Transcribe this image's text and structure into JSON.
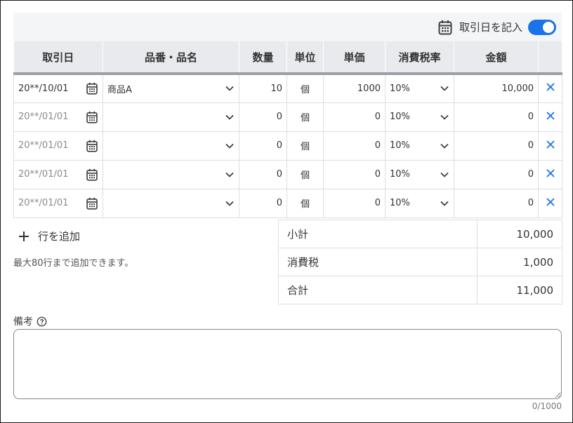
{
  "toolbar": {
    "record_date_label": "取引日を記入",
    "toggle_on": true
  },
  "table": {
    "headers": [
      "取引日",
      "品番・品名",
      "数量",
      "単位",
      "単価",
      "消費税率",
      "金額",
      ""
    ],
    "rows": [
      {
        "date": "20**/10/01",
        "date_placeholder": false,
        "item": "商品A",
        "qty": "10",
        "unit": "個",
        "price": "1000",
        "tax": "10%",
        "amount": "10,000"
      },
      {
        "date": "20**/01/01",
        "date_placeholder": true,
        "item": "",
        "qty": "0",
        "unit": "個",
        "price": "0",
        "tax": "10%",
        "amount": "0"
      },
      {
        "date": "20**/01/01",
        "date_placeholder": true,
        "item": "",
        "qty": "0",
        "unit": "個",
        "price": "0",
        "tax": "10%",
        "amount": "0"
      },
      {
        "date": "20**/01/01",
        "date_placeholder": true,
        "item": "",
        "qty": "0",
        "unit": "個",
        "price": "0",
        "tax": "10%",
        "amount": "0"
      },
      {
        "date": "20**/01/01",
        "date_placeholder": true,
        "item": "",
        "qty": "0",
        "unit": "個",
        "price": "0",
        "tax": "10%",
        "amount": "0"
      }
    ]
  },
  "add_row": {
    "label": "行を追加",
    "hint": "最大80行まで追加できます。"
  },
  "totals": [
    {
      "label": "小計",
      "value": "10,000"
    },
    {
      "label": "消費税",
      "value": "1,000"
    },
    {
      "label": "合計",
      "value": "11,000"
    }
  ],
  "remarks": {
    "label": "備考",
    "value": "",
    "counter": "0/1000"
  },
  "colors": {
    "accent": "#1a73e8",
    "header_bg": "#e8eaed"
  }
}
